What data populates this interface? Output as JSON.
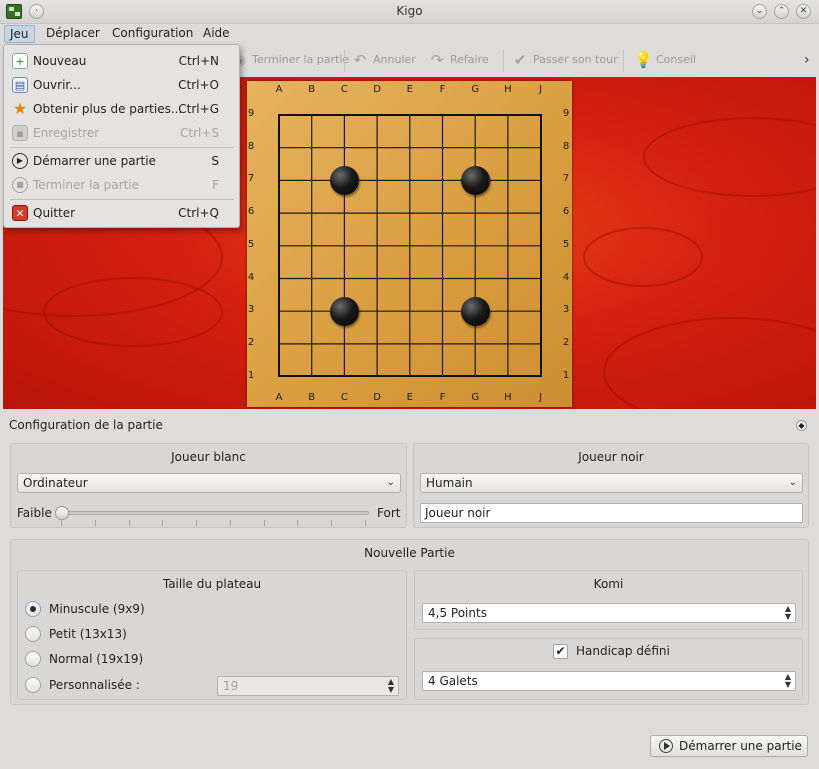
{
  "window": {
    "title": "Kigo",
    "min_glyph": "⌄",
    "max_glyph": "⌃",
    "close_glyph": "✕",
    "pin_glyph": "·"
  },
  "menubar": {
    "items": [
      "Jeu",
      "Déplacer",
      "Configuration",
      "Aide"
    ]
  },
  "toolbar": {
    "items": [
      "Terminer la partie",
      "Annuler",
      "Refaire",
      "Passer son tour",
      "Conseil"
    ],
    "overflow": "›"
  },
  "game_menu": {
    "items": [
      {
        "label": "Nouveau",
        "shortcut": "Ctrl+N",
        "icon": "new-document-icon",
        "enabled": true
      },
      {
        "label": "Ouvrir...",
        "shortcut": "Ctrl+O",
        "icon": "open-folder-icon",
        "enabled": true
      },
      {
        "label": "Obtenir plus de parties...",
        "shortcut": "Ctrl+G",
        "icon": "star-icon",
        "enabled": true
      },
      {
        "label": "Enregistrer",
        "shortcut": "Ctrl+S",
        "icon": "save-icon",
        "enabled": false
      },
      {
        "label": "Démarrer une partie",
        "shortcut": "S",
        "icon": "play-icon",
        "enabled": true
      },
      {
        "label": "Terminer la partie",
        "shortcut": "F",
        "icon": "stop-icon",
        "enabled": false
      },
      {
        "label": "Quitter",
        "shortcut": "Ctrl+Q",
        "icon": "quit-icon",
        "enabled": true
      }
    ]
  },
  "board": {
    "columns": [
      "A",
      "B",
      "C",
      "D",
      "E",
      "F",
      "G",
      "H",
      "J"
    ],
    "rows": [
      "9",
      "8",
      "7",
      "6",
      "5",
      "4",
      "3",
      "2",
      "1"
    ],
    "stones": [
      {
        "col": "C",
        "row": "7",
        "color": "black"
      },
      {
        "col": "G",
        "row": "7",
        "color": "black"
      },
      {
        "col": "C",
        "row": "3",
        "color": "black"
      },
      {
        "col": "G",
        "row": "3",
        "color": "black"
      }
    ]
  },
  "setup": {
    "title": "Configuration de la partie",
    "white_player": {
      "title": "Joueur blanc",
      "type": "Ordinateur",
      "weak_label": "Faible",
      "strong_label": "Fort",
      "strength_level": 0
    },
    "black_player": {
      "title": "Joueur noir",
      "type": "Humain",
      "name": "Joueur noir"
    },
    "new_game": {
      "title": "Nouvelle Partie",
      "board_size": {
        "title": "Taille du plateau",
        "options": [
          "Minuscule (9x9)",
          "Petit (13x13)",
          "Normal (19x19)",
          "Personnalisée :"
        ],
        "selected": 0,
        "custom_value": "19"
      },
      "komi": {
        "title": "Komi",
        "value": "4,5 Points"
      },
      "handicap": {
        "label": "Handicap défini",
        "checked": true,
        "value": "4 Galets"
      }
    },
    "start_button": "Démarrer une partie"
  }
}
